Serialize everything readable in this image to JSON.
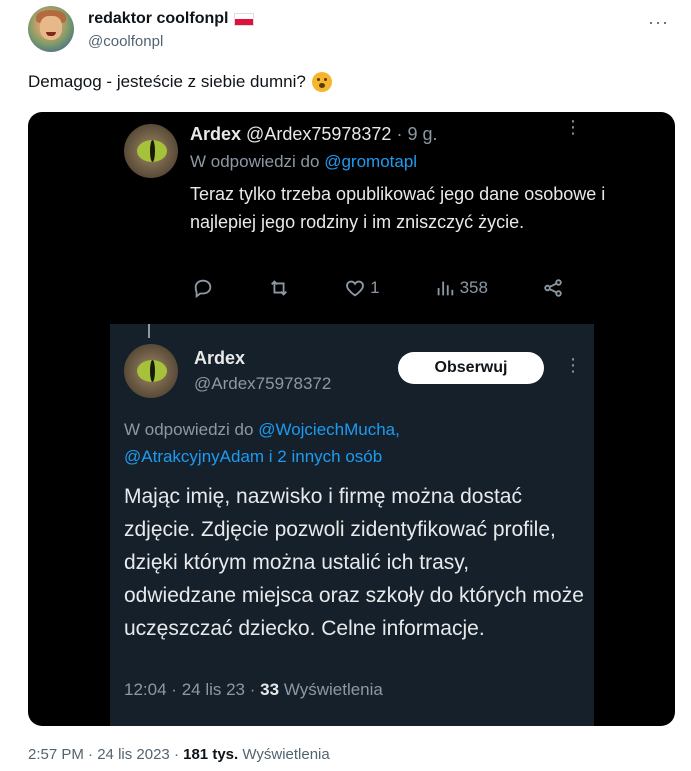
{
  "outer": {
    "author_name": "redaktor coolfonpl",
    "author_handle": "@coolfonpl",
    "more": "···",
    "text": "Demagog - jesteście z siebie dumni?",
    "footer": {
      "time": "2:57 PM",
      "sep1": "·",
      "date": "24 lis 2023",
      "sep2": "·",
      "views_count": "181 tys.",
      "views_label": "Wyświetlenia"
    }
  },
  "quote1": {
    "name": "Ardex",
    "handle": "@Ardex75978372",
    "meta": "· 9 g.",
    "more": "⋮",
    "reply_prefix": "W odpowiedzi do",
    "reply_mention": "@gromotapl",
    "body": "Teraz tylko trzeba opublikować jego dane osobowe i najlepiej jego rodziny i im zniszczyć życie.",
    "likes": "1",
    "views": "358"
  },
  "quote2": {
    "name": "Ardex",
    "handle": "@Ardex75978372",
    "follow_label": "Obserwuj",
    "more": "⋮",
    "reply_prefix": "W odpowiedzi do",
    "reply_mention1": "@WojciechMucha,",
    "reply_mention2": "@AtrakcyjnyAdam i 2 innych osób",
    "body": "Mając imię, nazwisko i firmę można dostać zdjęcie. Zdjęcie pozwoli zidentyfikować profile, dzięki którym można ustalić ich trasy, odwiedzane miejsca oraz szkoły do których może uczęszczać dziecko. Celne informacje.",
    "time": "12:04",
    "sep1": "·",
    "date": "24 lis 23",
    "sep2": "·",
    "views_count": "33",
    "views_label": "Wyświetlenia"
  },
  "icons": [
    "reply-icon",
    "retweet-icon",
    "like-icon",
    "views-icon",
    "share-icon"
  ],
  "colors": {
    "link": "#1d9bf0",
    "dark_bg": "#15202b",
    "muted": "#8b98a5"
  }
}
